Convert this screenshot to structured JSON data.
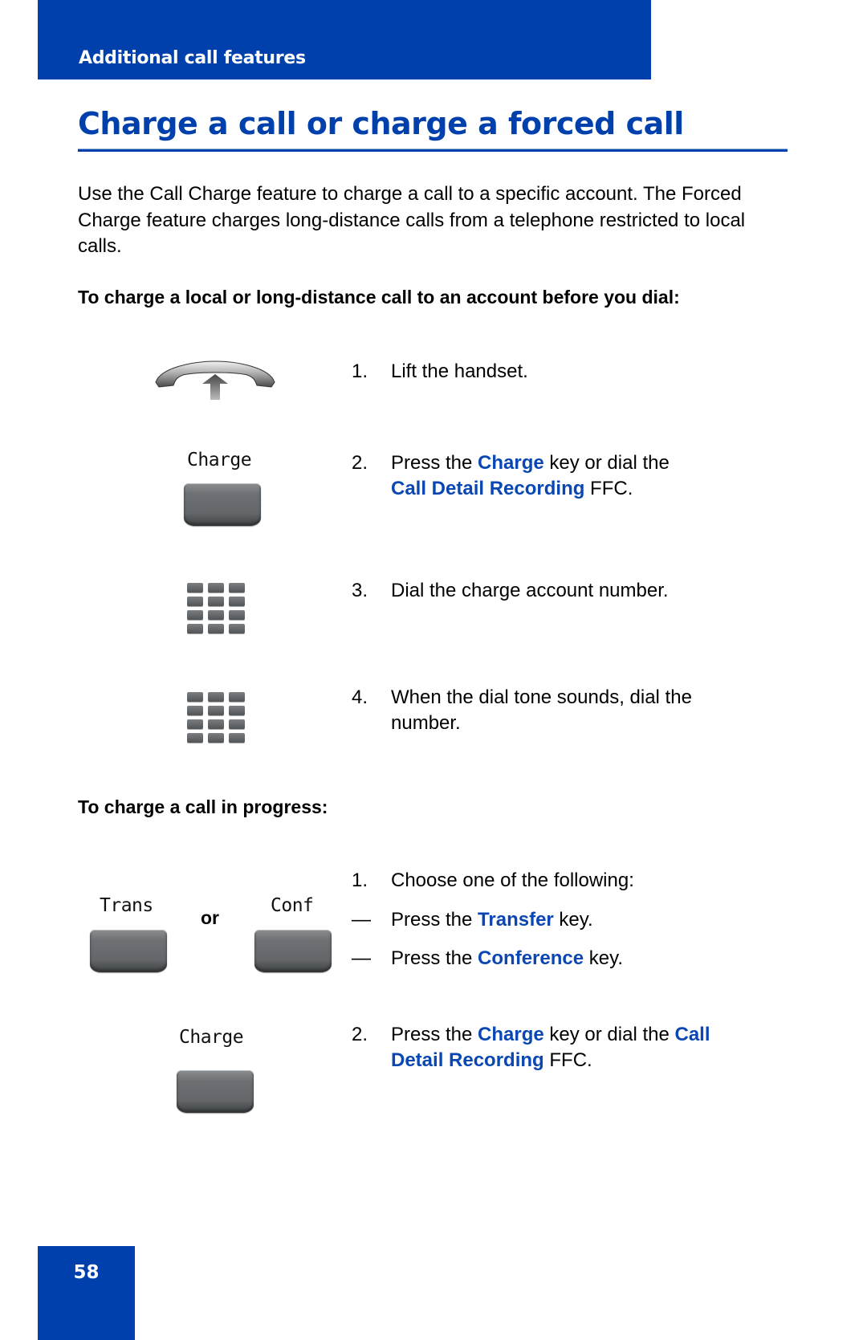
{
  "header": {
    "section_label": "Additional call features",
    "accent_color": "#0040ad"
  },
  "page": {
    "title": "Charge a call or charge a forced call",
    "intro": "Use the Call Charge feature to charge a call to a specific account. The Forced Charge feature charges long-distance calls from a telephone restricted to local calls.",
    "page_number": "58"
  },
  "section1": {
    "heading": "To charge a local or long-distance call to an account before you dial:",
    "steps": [
      {
        "num": "1.",
        "icon": "handset-lift-icon",
        "parts": [
          {
            "text": "Lift the handset.",
            "hl": false
          }
        ]
      },
      {
        "num": "2.",
        "icon": "charge-softkey",
        "key_label": "Charge",
        "line1": [
          {
            "text": "Press the ",
            "hl": false
          },
          {
            "text": "Charge",
            "hl": true
          },
          {
            "text": " key or dial the",
            "hl": false
          }
        ],
        "line2": [
          {
            "text": "Call Detail Recording",
            "hl": true
          },
          {
            "text": " FFC.",
            "hl": false
          }
        ]
      },
      {
        "num": "3.",
        "icon": "dialpad-icon",
        "parts": [
          {
            "text": "Dial the charge account number.",
            "hl": false
          }
        ]
      },
      {
        "num": "4.",
        "icon": "dialpad-icon",
        "line1": "When the dial tone sounds, dial the",
        "line2": "number."
      }
    ]
  },
  "section2": {
    "heading": "To charge a call in progress:",
    "or_label": "or",
    "trans_key_label": "Trans",
    "conf_key_label": "Conf",
    "charge_key_label": "Charge",
    "step1": {
      "num": "1.",
      "text": "Choose one of the following:",
      "options": [
        {
          "dash": "—",
          "pre": "Press the ",
          "hl": "Transfer",
          "post": " key."
        },
        {
          "dash": "—",
          "pre": "Press the ",
          "hl": "Conference",
          "post": " key."
        }
      ]
    },
    "step2": {
      "num": "2.",
      "line1": [
        {
          "text": "Press the ",
          "hl": false
        },
        {
          "text": "Charge",
          "hl": true
        },
        {
          "text": " key or dial the ",
          "hl": false
        },
        {
          "text": "Call",
          "hl": true
        }
      ],
      "line2": [
        {
          "text": "Detail Recording",
          "hl": true
        },
        {
          "text": " FFC.",
          "hl": false
        }
      ]
    }
  }
}
